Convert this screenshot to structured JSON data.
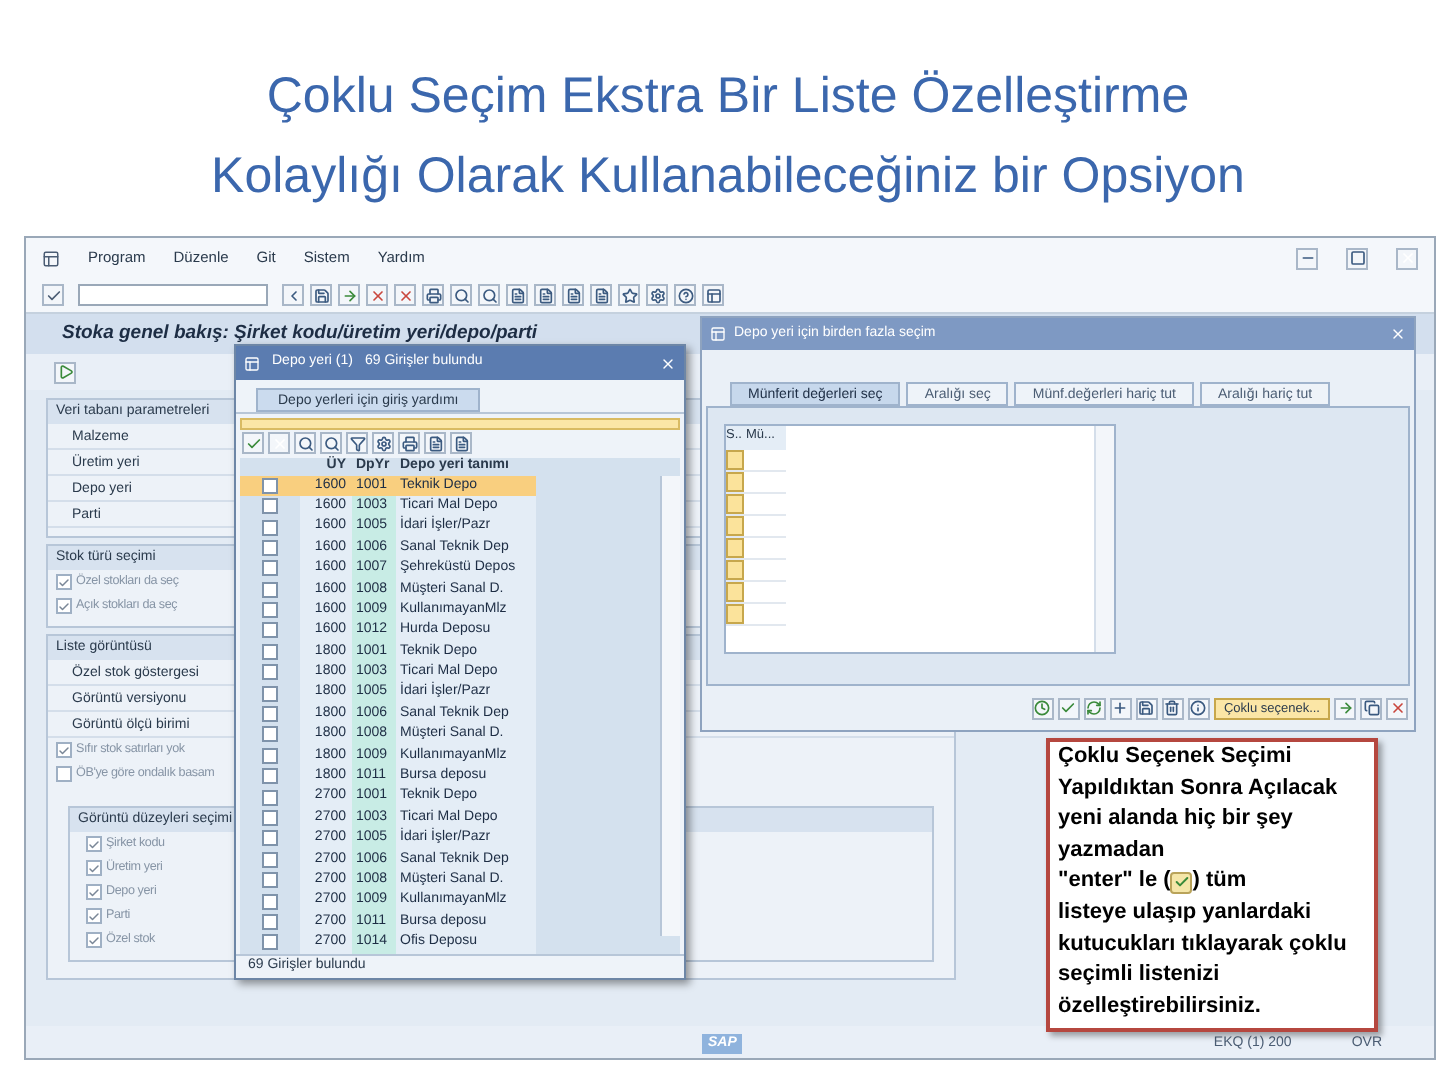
{
  "slide_title": [
    "Çoklu Seçim Ekstra Bir Liste Özelleştirme",
    "Kolaylığı Olarak Kullanabileceğiniz bir Opsiyon"
  ],
  "menu": [
    "Program",
    "Düzenle",
    "Git",
    "Sistem",
    "Yardım"
  ],
  "screen_title": "Stoka genel bakış: Şirket kodu/üretim yeri/depo/parti",
  "db_params": {
    "title": "Veri tabanı parametreleri",
    "fields": [
      "Malzeme",
      "Üretim yeri",
      "Depo yeri",
      "Parti"
    ]
  },
  "stock_type": {
    "title": "Stok türü seçimi",
    "options": [
      {
        "label": "Özel stokları da seç",
        "checked": true
      },
      {
        "label": "Açık stokları da seç",
        "checked": true
      }
    ]
  },
  "list_display": {
    "title": "Liste görüntüsü",
    "fields": [
      "Özel stok göstergesi",
      "Görüntü versiyonu",
      "Görüntü ölçü birimi"
    ],
    "options": [
      {
        "label": "Sıfır stok satırları yok",
        "checked": true
      },
      {
        "label": "ÖB'ye göre ondalık basam",
        "checked": false
      }
    ],
    "levels": {
      "title": "Görüntü düzeyleri seçimi",
      "options": [
        {
          "label": "Şirket kodu",
          "checked": true
        },
        {
          "label": "Üretim yeri",
          "checked": true
        },
        {
          "label": "Depo yeri",
          "checked": true
        },
        {
          "label": "Parti",
          "checked": true
        },
        {
          "label": "Özel stok",
          "checked": true
        }
      ]
    }
  },
  "help_dialog": {
    "title": "Depo yeri (1)",
    "count": "69 Girişler bulundu",
    "tab": "Depo yerleri için giriş yardımı",
    "columns": [
      "ÜY",
      "DpYr",
      "Depo yeri tanımı"
    ],
    "rows": [
      {
        "cells": [
          "1600",
          "1001",
          "Teknik Depo"
        ],
        "selected": true,
        "checked": false
      },
      {
        "cells": [
          "1600",
          "1003",
          "Ticari Mal Depo"
        ],
        "selected": false,
        "checked": false
      },
      {
        "cells": [
          "1600",
          "1005",
          "İdari İşler/Pazr"
        ],
        "selected": false,
        "checked": false
      },
      {
        "cells": [
          "1600",
          "1006",
          "Sanal Teknik Dep"
        ],
        "selected": false,
        "checked": false
      },
      {
        "cells": [
          "1600",
          "1007",
          "Şehreküstü Depos"
        ],
        "selected": false,
        "checked": false
      },
      {
        "cells": [
          "1600",
          "1008",
          "Müşteri Sanal D."
        ],
        "selected": false,
        "checked": false
      },
      {
        "cells": [
          "1600",
          "1009",
          "KullanımayanMlz"
        ],
        "selected": false,
        "checked": false
      },
      {
        "cells": [
          "1600",
          "1012",
          "Hurda Deposu"
        ],
        "selected": false,
        "checked": false
      },
      {
        "cells": [
          "1800",
          "1001",
          "Teknik Depo"
        ],
        "selected": false,
        "checked": false
      },
      {
        "cells": [
          "1800",
          "1003",
          "Ticari Mal Depo"
        ],
        "selected": false,
        "checked": false
      },
      {
        "cells": [
          "1800",
          "1005",
          "İdari İşler/Pazr"
        ],
        "selected": false,
        "checked": false
      },
      {
        "cells": [
          "1800",
          "1006",
          "Sanal Teknik Dep"
        ],
        "selected": false,
        "checked": false
      },
      {
        "cells": [
          "1800",
          "1008",
          "Müşteri Sanal D."
        ],
        "selected": false,
        "checked": false
      },
      {
        "cells": [
          "1800",
          "1009",
          "KullanımayanMlz"
        ],
        "selected": false,
        "checked": false
      },
      {
        "cells": [
          "1800",
          "1011",
          "Bursa deposu"
        ],
        "selected": false,
        "checked": false
      },
      {
        "cells": [
          "2700",
          "1001",
          "Teknik Depo"
        ],
        "selected": false,
        "checked": false
      },
      {
        "cells": [
          "2700",
          "1003",
          "Ticari Mal Depo"
        ],
        "selected": false,
        "checked": false
      },
      {
        "cells": [
          "2700",
          "1005",
          "İdari İşler/Pazr"
        ],
        "selected": false,
        "checked": false
      },
      {
        "cells": [
          "2700",
          "1006",
          "Sanal Teknik Dep"
        ],
        "selected": false,
        "checked": false
      },
      {
        "cells": [
          "2700",
          "1008",
          "Müşteri Sanal D."
        ],
        "selected": false,
        "checked": false
      },
      {
        "cells": [
          "2700",
          "1009",
          "KullanımayanMlz"
        ],
        "selected": false,
        "checked": false
      },
      {
        "cells": [
          "2700",
          "1011",
          "Bursa deposu"
        ],
        "selected": false,
        "checked": false
      },
      {
        "cells": [
          "2700",
          "1014",
          "Ofis Deposu"
        ],
        "selected": false,
        "checked": false
      }
    ],
    "footer": "69 Girişler bulundu"
  },
  "multi_dialog": {
    "title": "Depo yeri için birden fazla seçim",
    "tabs": [
      {
        "label": "Münferit değerleri seç",
        "selected": true
      },
      {
        "label": "Aralığı seç",
        "selected": false
      },
      {
        "label": "Münf.değerleri hariç tut",
        "selected": false
      },
      {
        "label": "Aralığı hariç tut",
        "selected": false
      }
    ],
    "columns": [
      "S..",
      "Mü..."
    ],
    "button": "Çoklu seçenek..."
  },
  "callout": {
    "text_top": "Çoklu Seçenek Seçimi Yapıldıktan Sonra Açılacak yeni alanda hiç bir şey yazmadan",
    "icon_before": "\"enter\" le (",
    "icon_after": ") tüm",
    "text_bottom": "listeye ulaşıp yanlardaki kutucukları tıklayarak çoklu seçimli listenizi özelleştirebilirsiniz."
  },
  "status_bar": {
    "logo": "SAP",
    "system": "EKQ (1) 200",
    "mode": "OVR"
  }
}
